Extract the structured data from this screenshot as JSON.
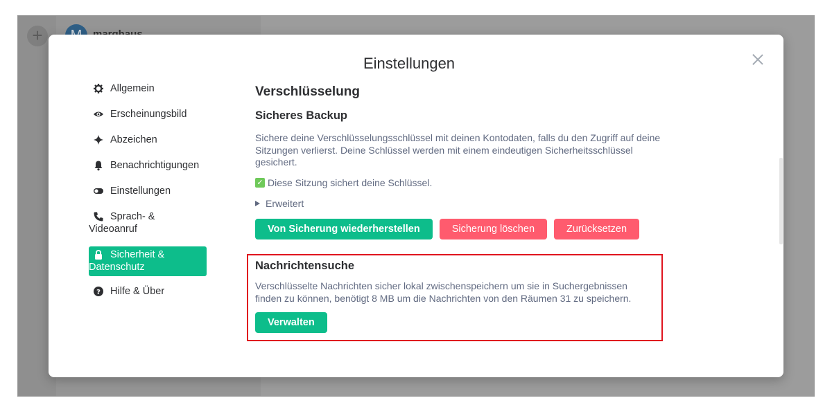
{
  "background": {
    "plus_label": "+",
    "avatar_letter": "M",
    "username": "marghaus",
    "chevron": "⌄"
  },
  "modal": {
    "title": "Einstellungen",
    "close_icon": "close-icon"
  },
  "sidebar": {
    "items": [
      {
        "label": "Allgemein",
        "icon": "gear-icon"
      },
      {
        "label": "Erscheinungsbild",
        "icon": "eye-icon"
      },
      {
        "label": "Abzeichen",
        "icon": "sparkle-icon"
      },
      {
        "label": "Benachrichtigungen",
        "icon": "bell-icon"
      },
      {
        "label": "Einstellungen",
        "icon": "toggle-icon"
      },
      {
        "label": "Sprach- & Videoanruf",
        "icon": "phone-icon"
      },
      {
        "label": "Sicherheit & Datenschutz",
        "icon": "lock-icon",
        "active": true
      },
      {
        "label": "Hilfe & Über",
        "icon": "help-icon"
      }
    ]
  },
  "content": {
    "heading": "Verschlüsselung",
    "backup_heading": "Sicheres Backup",
    "backup_description": "Sichere deine Verschlüsselungsschlüssel mit deinen Kontodaten, falls du den Zugriff auf deine Sitzungen verlierst. Deine Schlüssel werden mit einem eindeutigen Sicherheitsschlüssel gesichert.",
    "backup_status": "Diese Sitzung sichert deine Schlüssel.",
    "advanced_label": "Erweitert",
    "buttons": {
      "restore": "Von Sicherung wiederherstellen",
      "delete": "Sicherung löschen",
      "reset": "Zurücksetzen"
    },
    "search_heading": "Nachrichtensuche",
    "search_description": "Verschlüsselte Nachrichten sicher lokal zwischenspeichern um sie in Suchergebnissen finden zu können, benötigt 8 MB um die Nachrichten von den Räumen 31 zu speichern.",
    "manage_button": "Verwalten"
  },
  "colors": {
    "accent": "#0dbd8b",
    "danger": "#ff5b6e",
    "highlight_border": "#e0141e",
    "text_primary": "#2e2f32",
    "text_secondary": "#616a81"
  }
}
